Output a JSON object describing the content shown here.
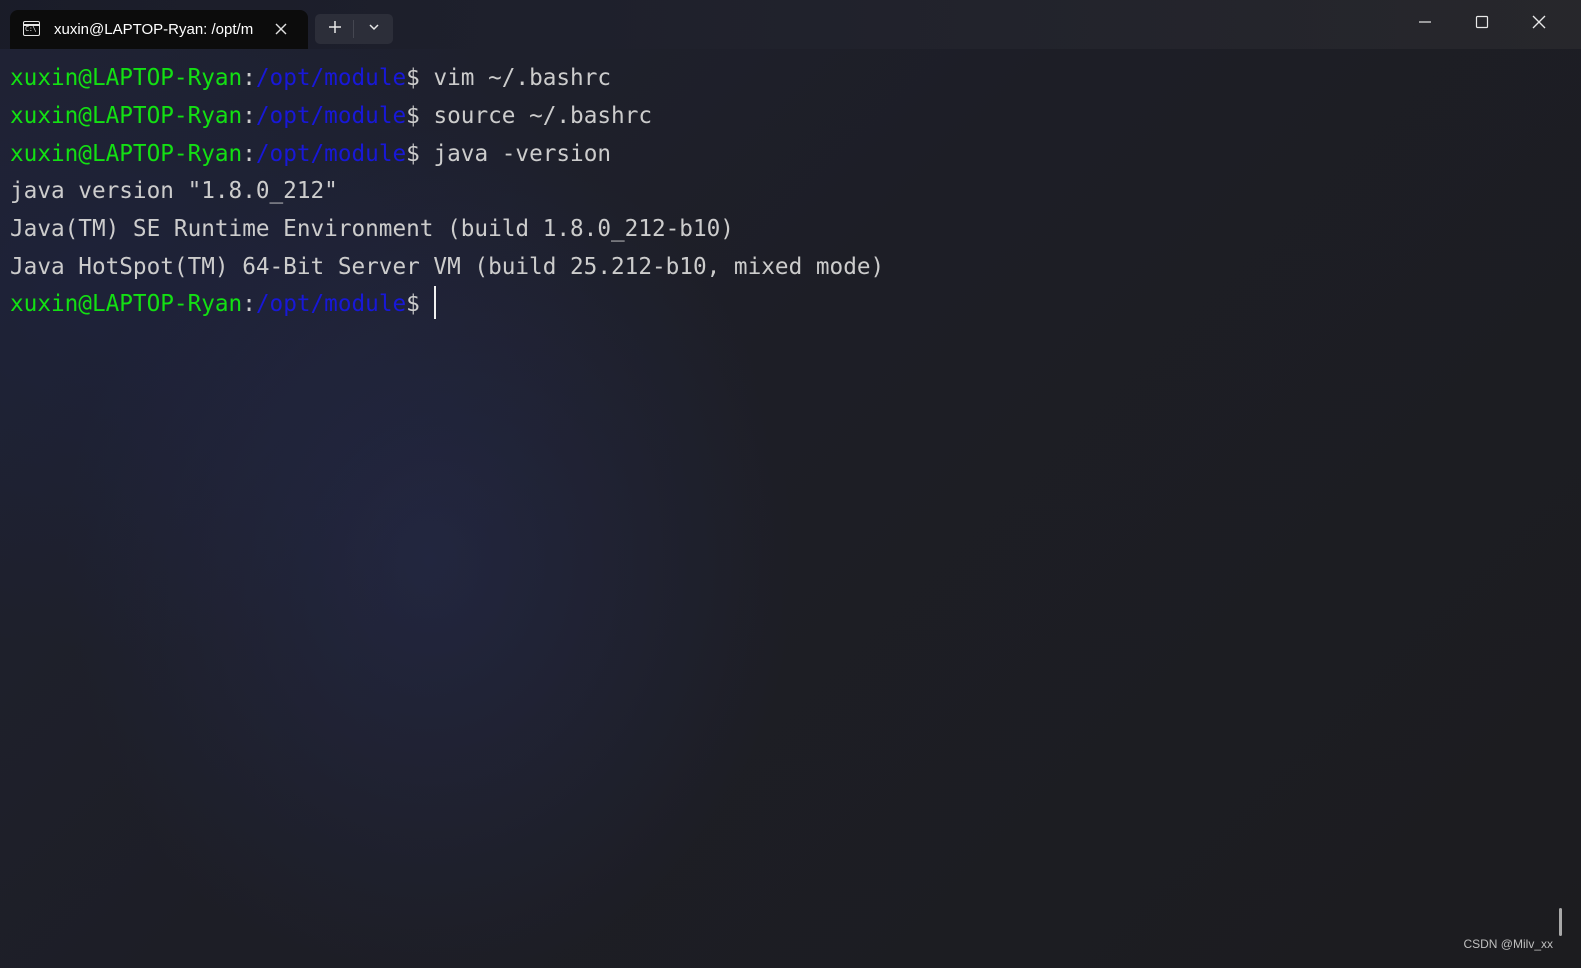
{
  "window": {
    "tab_title": "xuxin@LAPTOP-Ryan: /opt/m",
    "tab_icon": "terminal-icon",
    "controls": {
      "new_tab_icon": "plus-icon",
      "dropdown_icon": "chevron-down-icon",
      "minimize_icon": "minimize-icon",
      "maximize_icon": "maximize-icon",
      "close_icon": "close-icon"
    }
  },
  "terminal": {
    "prompt": {
      "user_host": "xuxin@LAPTOP-Ryan",
      "colon": ":",
      "path": "/opt/module",
      "symbol": "$"
    },
    "lines": [
      {
        "type": "command",
        "command": " vim ~/.bashrc"
      },
      {
        "type": "command",
        "command": " source ~/.bashrc"
      },
      {
        "type": "command",
        "command": " java -version"
      },
      {
        "type": "output",
        "text": "java version \"1.8.0_212\""
      },
      {
        "type": "output",
        "text": "Java(TM) SE Runtime Environment (build 1.8.0_212-b10)"
      },
      {
        "type": "output",
        "text": "Java HotSpot(TM) 64-Bit Server VM (build 25.212-b10, mixed mode)"
      },
      {
        "type": "prompt-active",
        "command": " "
      }
    ]
  },
  "watermark": "CSDN @Milv_xx",
  "colors": {
    "user_host": "#13e013",
    "path": "#1818d8",
    "text": "#cccccc",
    "tab_background": "#0c0c0c"
  }
}
